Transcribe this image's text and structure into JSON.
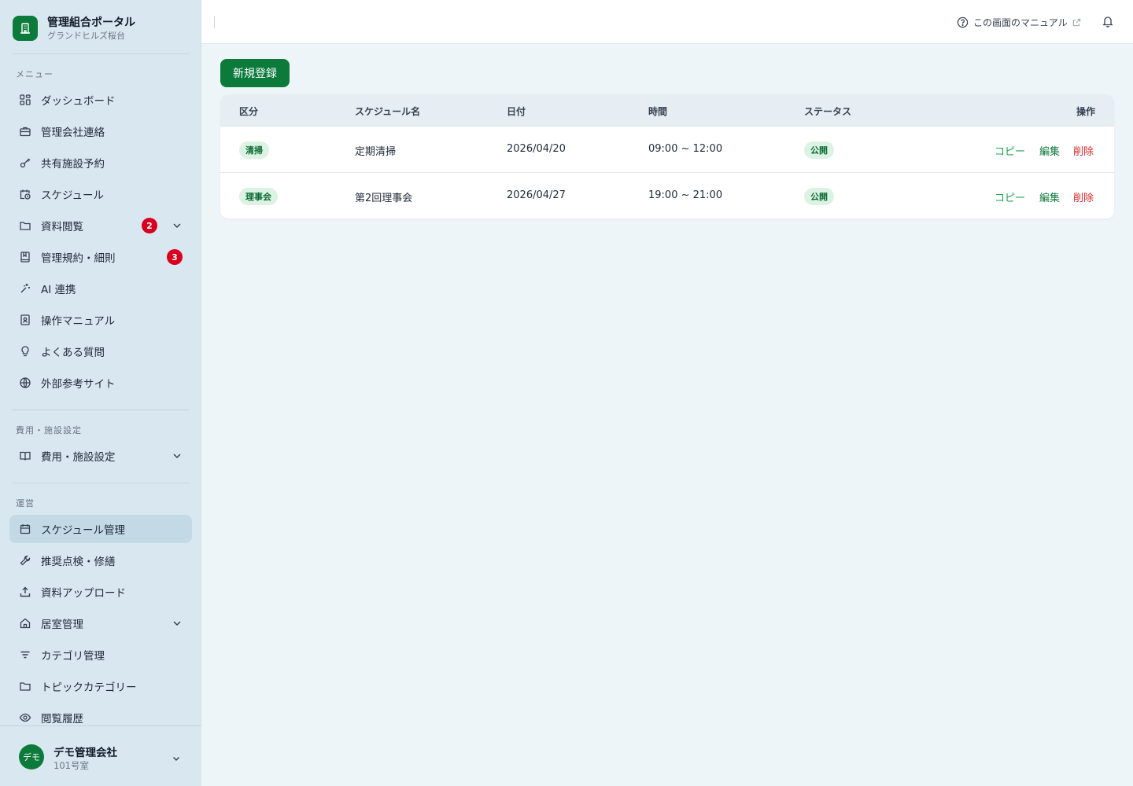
{
  "brand": {
    "title": "管理組合ポータル",
    "subtitle": "グランドヒルズ桜台"
  },
  "sidebar": {
    "section_menu": "メニュー",
    "menu_items": [
      {
        "label": "ダッシュボード",
        "icon": "grid-icon"
      },
      {
        "label": "管理会社連絡",
        "icon": "briefcase-icon"
      },
      {
        "label": "共有施設予約",
        "icon": "key-icon"
      },
      {
        "label": "スケジュール",
        "icon": "calendar-clock-icon"
      },
      {
        "label": "資料閲覧",
        "icon": "folder-icon",
        "badge": "2"
      },
      {
        "label": "管理規約・細則",
        "icon": "book-icon",
        "badge": "3"
      },
      {
        "label": "AI 連携",
        "icon": "sparkle-icon"
      },
      {
        "label": "操作マニュアル",
        "icon": "manual-icon"
      },
      {
        "label": "よくある質問",
        "icon": "lightbulb-icon"
      },
      {
        "label": "外部参考サイト",
        "icon": "globe-icon"
      }
    ],
    "section_cost": "費用・施設設定",
    "cost_items": [
      {
        "label": "費用・施設設定",
        "icon": "open-book-icon"
      }
    ],
    "section_ops": "運営",
    "ops_items": [
      {
        "label": "スケジュール管理",
        "icon": "calendar-icon"
      },
      {
        "label": "推奨点検・修繕",
        "icon": "wrench-icon"
      },
      {
        "label": "資料アップロード",
        "icon": "upload-icon"
      },
      {
        "label": "居室管理",
        "icon": "home-icon"
      },
      {
        "label": "カテゴリ管理",
        "icon": "filter-icon"
      },
      {
        "label": "トピックカテゴリー",
        "icon": "folder-icon"
      },
      {
        "label": "閲覧履歴",
        "icon": "eye-icon"
      }
    ]
  },
  "user": {
    "avatar": "デモ",
    "name": "デモ管理会社",
    "room": "101号室"
  },
  "header": {
    "manual_link": "この画面のマニュアル"
  },
  "main": {
    "new_button": "新規登録",
    "columns": [
      "区分",
      "スケジュール名",
      "日付",
      "時間",
      "ステータス",
      "操作"
    ],
    "rows": [
      {
        "category": "清掃",
        "name": "定期清掃",
        "date": "2026/04/20",
        "time": "09:00 ~ 12:00",
        "status": "公開"
      },
      {
        "category": "理事会",
        "name": "第2回理事会",
        "date": "2026/04/27",
        "time": "19:00 ~ 21:00",
        "status": "公開"
      }
    ],
    "actions": {
      "copy": "コピー",
      "edit": "編集",
      "delete": "削除"
    }
  },
  "colors": {
    "brand": "#0b7a3b",
    "badge": "#d8001e",
    "delete": "#dc2626",
    "copy": "#17a34a"
  }
}
